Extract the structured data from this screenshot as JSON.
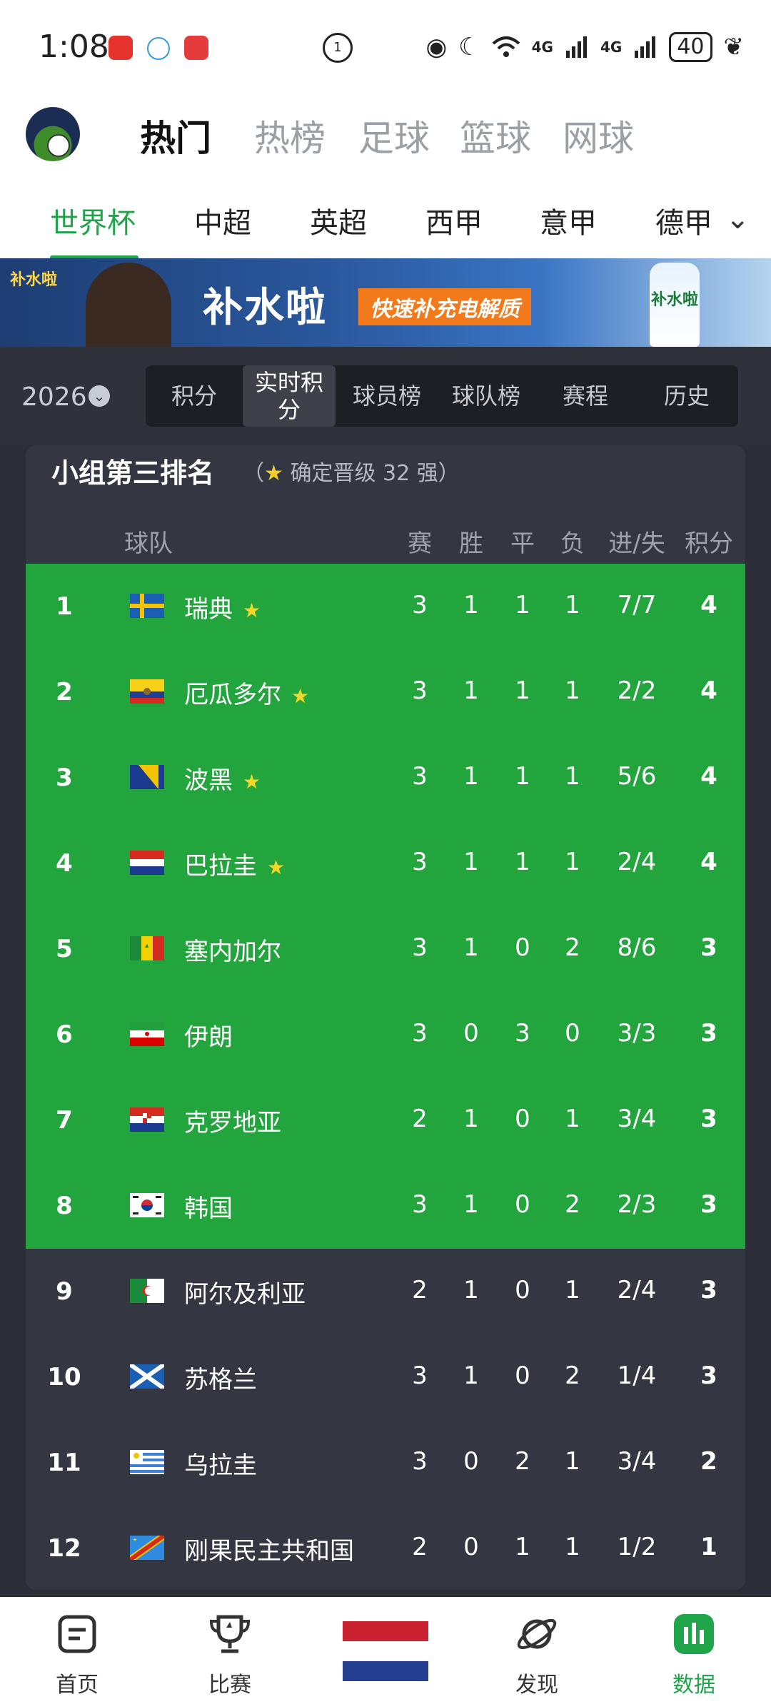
{
  "status_bar": {
    "time": "1:08",
    "network_1": "4G",
    "network_2": "4G",
    "battery": "40"
  },
  "main_tabs": [
    {
      "label": "热门",
      "active": true
    },
    {
      "label": "热榜",
      "active": false
    },
    {
      "label": "足球",
      "active": false
    },
    {
      "label": "篮球",
      "active": false
    },
    {
      "label": "网球",
      "active": false
    }
  ],
  "league_tabs": [
    {
      "label": "世界杯",
      "active": true
    },
    {
      "label": "中超",
      "active": false
    },
    {
      "label": "英超",
      "active": false
    },
    {
      "label": "西甲",
      "active": false
    },
    {
      "label": "意甲",
      "active": false
    },
    {
      "label": "德甲",
      "active": false
    }
  ],
  "banner": {
    "brand": "补水啦",
    "title": "补水啦",
    "slogan": "快速补充电解质",
    "bottle_label": "补水啦"
  },
  "season": "2026",
  "segments": [
    {
      "label": "积分",
      "active": false
    },
    {
      "label": "实时积分",
      "active": true
    },
    {
      "label": "球员榜",
      "active": false
    },
    {
      "label": "球队榜",
      "active": false
    },
    {
      "label": "赛程",
      "active": false
    },
    {
      "label": "历史",
      "active": false
    }
  ],
  "table": {
    "title": "小组第三排名",
    "note_open": "（",
    "note_star": "★",
    "note_text": " 确定晋级 32 强）",
    "headers": {
      "team": "球队",
      "played": "赛",
      "win": "胜",
      "draw": "平",
      "loss": "负",
      "goals": "进/失",
      "points": "积分"
    },
    "rows": [
      {
        "rank": "1",
        "team": "瑞典",
        "star": "★",
        "played": "3",
        "win": "1",
        "draw": "1",
        "loss": "1",
        "goals": "7/7",
        "points": "4"
      },
      {
        "rank": "2",
        "team": "厄瓜多尔",
        "star": "★",
        "played": "3",
        "win": "1",
        "draw": "1",
        "loss": "1",
        "goals": "2/2",
        "points": "4"
      },
      {
        "rank": "3",
        "team": "波黑",
        "star": "★",
        "played": "3",
        "win": "1",
        "draw": "1",
        "loss": "1",
        "goals": "5/6",
        "points": "4"
      },
      {
        "rank": "4",
        "team": "巴拉圭",
        "star": "★",
        "played": "3",
        "win": "1",
        "draw": "1",
        "loss": "1",
        "goals": "2/4",
        "points": "4"
      },
      {
        "rank": "5",
        "team": "塞内加尔",
        "star": "",
        "played": "3",
        "win": "1",
        "draw": "0",
        "loss": "2",
        "goals": "8/6",
        "points": "3"
      },
      {
        "rank": "6",
        "team": "伊朗",
        "star": "",
        "played": "3",
        "win": "0",
        "draw": "3",
        "loss": "0",
        "goals": "3/3",
        "points": "3"
      },
      {
        "rank": "7",
        "team": "克罗地亚",
        "star": "",
        "played": "2",
        "win": "1",
        "draw": "0",
        "loss": "1",
        "goals": "3/4",
        "points": "3"
      },
      {
        "rank": "8",
        "team": "韩国",
        "star": "",
        "played": "3",
        "win": "1",
        "draw": "0",
        "loss": "2",
        "goals": "2/3",
        "points": "3"
      },
      {
        "rank": "9",
        "team": "阿尔及利亚",
        "star": "",
        "played": "2",
        "win": "1",
        "draw": "0",
        "loss": "1",
        "goals": "2/4",
        "points": "3"
      },
      {
        "rank": "10",
        "team": "苏格兰",
        "star": "",
        "played": "3",
        "win": "1",
        "draw": "0",
        "loss": "2",
        "goals": "1/4",
        "points": "3"
      },
      {
        "rank": "11",
        "team": "乌拉圭",
        "star": "",
        "played": "3",
        "win": "0",
        "draw": "2",
        "loss": "1",
        "goals": "3/4",
        "points": "2"
      },
      {
        "rank": "12",
        "team": "刚果民主共和国",
        "star": "",
        "played": "2",
        "win": "0",
        "draw": "1",
        "loss": "1",
        "goals": "1/2",
        "points": "1"
      }
    ]
  },
  "bottom_nav": [
    {
      "label": "首页",
      "icon": "home-doc-icon",
      "active": false
    },
    {
      "label": "比赛",
      "icon": "trophy-icon",
      "active": false
    },
    {
      "label": "",
      "icon": "netherlands-flag-icon",
      "active": false
    },
    {
      "label": "发现",
      "icon": "planet-icon",
      "active": false
    },
    {
      "label": "数据",
      "icon": "bar-chart-icon",
      "active": true
    }
  ],
  "colors": {
    "accent": "#1fa44a",
    "qualified_row": "#23a53e",
    "card_bg": "#343741",
    "page_bg": "#2b2e36",
    "star": "#f2cf2e"
  }
}
